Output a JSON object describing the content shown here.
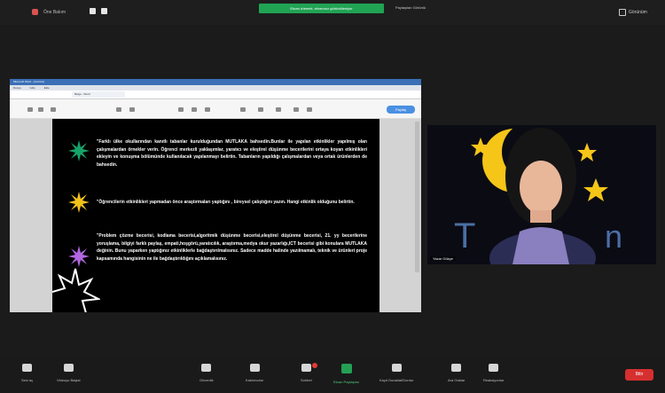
{
  "topbar": {
    "app_label": "Öne Bakım",
    "banner": "Ekran izlemek, ekranınız görüntüleniyor",
    "share_label": "Paylaşılan Görüntü",
    "view_label": "Görünüm"
  },
  "screen": {
    "window_title": "Microsoft Word - Çevrimiçi",
    "tabs": [
      "Dosya",
      "Giriş",
      "Ekle"
    ],
    "doc_tab": "Belge - Word",
    "share_button": "Paylaş",
    "paragraphs": [
      "\"Farklı ülke okullarından kanıtlı tabanlar kurulduğundan MUTLAKA bahsedin.Bunlar ile yapılan etkinlikler yapılmış olan çalışmalardan örnekler verin. Öğrenci merkezli yaklaşımlar, yaratıcı ve eleştirel düşünme becerilerini ortaya koyan etkinlikleri ekleyin ve konuşma bölümünde kullanılacak yapılanmayı belirtin. Tabanların yapıldığı çalışmalardan veya ortak ürünlerden de bahsedin.",
      "\"Öğrencilerin etkinlikleri yapmadan önce araştırmaları yaptığını , bireysel çalıştığını yazın. Hangi etkinlik olduğunu belirtin.",
      "\"Problem çözme becerisi, kodlama becerisi,algoritmik düşünme becerisi,eleştirel düşünme becerisi, 21. yy becerilerine yoruşlama, bilgiyi farklı paylaş, empati,hoşgörü,yaratıcılık, araştırma,medya okur yazarlığı,ICT becerisi gibi konulara MUTLAKA değinin. Bunu yaparken yaptığınız etkinliklerle bağdaştırılmalısınız. Sadece madde halinde yazılmamalı, teknik ve ürünleri proje kapsamında hangisinin ne ile bağdaştırıldığını açıklamalısınız."
    ]
  },
  "video": {
    "name": "Yazar Gökçe"
  },
  "bottombar": {
    "controls": [
      {
        "label": "Sesi aç"
      },
      {
        "label": "Videoyu Başlat"
      },
      {
        "label": "Güvenlik"
      },
      {
        "label": "Katılımcılar"
      },
      {
        "label": "Sohbet"
      },
      {
        "label": "Ekran Paylaşımı"
      },
      {
        "label": "Kayıt Duraklat/Durdur"
      },
      {
        "label": "Ara Odalar"
      },
      {
        "label": "Reaksiyonlar"
      }
    ],
    "end_label": "Bitir"
  },
  "colors": {
    "banner": "#21a354",
    "end": "#d62f2f",
    "slide_bg": "#000000",
    "bullet1": "#16a36a",
    "bullet2": "#f2c21b",
    "bullet3": "#b266e0"
  }
}
